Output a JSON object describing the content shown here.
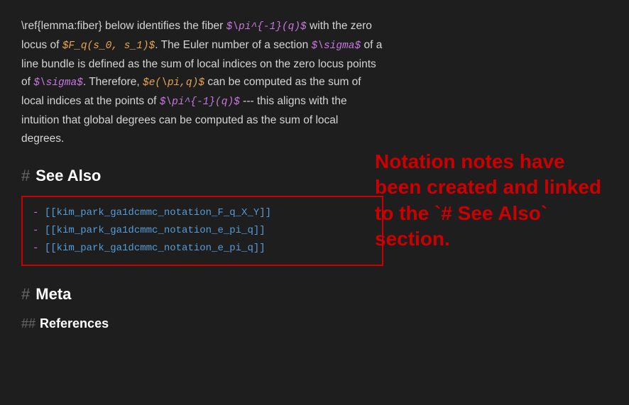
{
  "page": {
    "background": "#1e1e1e"
  },
  "content": {
    "paragraph1": "\\ref{lemma:fiber} below identifies the fiber ",
    "math1": "$\\pi^{-1}(q)$",
    "paragraph1b": " with the zero locus of ",
    "math2": "$F_q(s_0,  s_1)$",
    "paragraph1c": ". The Euler number of a section ",
    "math3": "$\\sigma$",
    "paragraph1d": " of a line bundle is defined as the sum of local indices on the zero locus points of ",
    "math4": "$\\sigma$",
    "paragraph1e": ". Therefore, ",
    "math5": "$e(\\pi,q)$",
    "paragraph1f": " can be computed as the sum of local indices at the points of ",
    "math6": "$\\pi^{-1}(q)$",
    "paragraph1g": " --- this aligns with the intuition that global degrees can be computed as the sum of local degrees."
  },
  "sections": {
    "see_also": {
      "hash": "#",
      "title": "See Also",
      "items": [
        "- [[kim_park_ga1dcmmc_notation_F_q_X_Y]]",
        "- [[kim_park_ga1dcmmc_notation_e_pi_q]]",
        "- [[kim_park_ga1dcmmc_notation_e_pi_q]]"
      ]
    },
    "meta": {
      "hash": "#",
      "title": "Meta",
      "sub": {
        "hash": "##",
        "title": "References"
      }
    }
  },
  "annotation": {
    "text": "Notation notes have been created and linked to the `# See Also` section."
  }
}
